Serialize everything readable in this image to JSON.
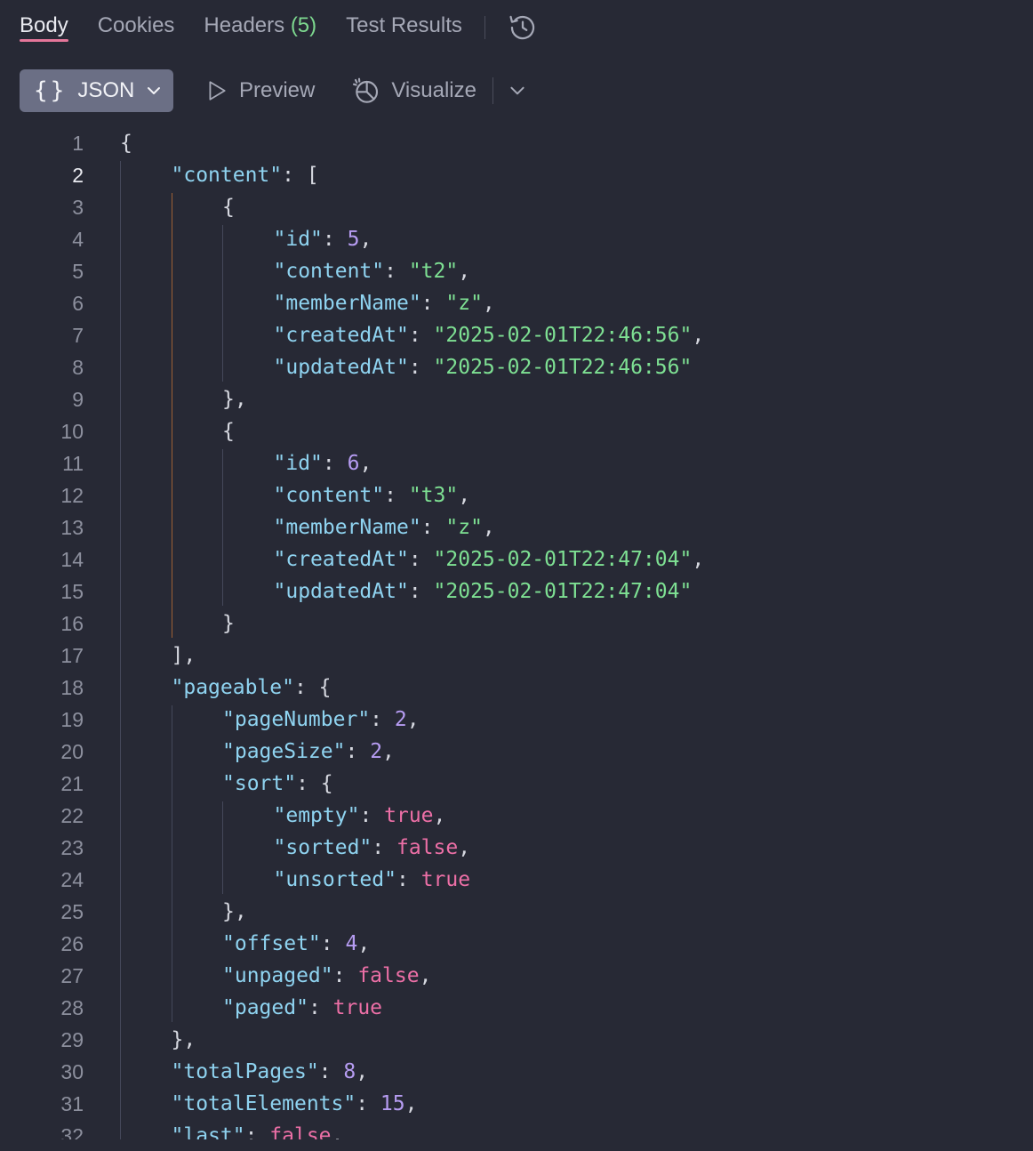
{
  "tabs": [
    {
      "label": "Body"
    },
    {
      "label": "Cookies"
    },
    {
      "label": "Headers",
      "count": "(5)"
    },
    {
      "label": "Test Results"
    }
  ],
  "toolbar": {
    "format_braces": "{}",
    "format_label": "JSON",
    "preview_label": "Preview",
    "visualize_label": "Visualize"
  },
  "colors": {
    "background": "#272935",
    "active_tab_underline": "#e5769a",
    "key": "#8fd3f0",
    "string": "#7ee093",
    "number": "#b69cf2",
    "boolean": "#ec6fa6"
  },
  "icons": [
    "history-icon",
    "chevron-down-icon",
    "play-icon",
    "visualize-icon"
  ],
  "code": {
    "current_line": 2,
    "lines": [
      [
        [
          "p",
          "{"
        ]
      ],
      [
        [
          "k",
          "\"content\""
        ],
        [
          "p",
          ": ["
        ]
      ],
      [
        [
          "p",
          "{"
        ]
      ],
      [
        [
          "k",
          "\"id\""
        ],
        [
          "p",
          ": "
        ],
        [
          "n",
          "5"
        ],
        [
          "p",
          ","
        ]
      ],
      [
        [
          "k",
          "\"content\""
        ],
        [
          "p",
          ": "
        ],
        [
          "s",
          "\"t2\""
        ],
        [
          "p",
          ","
        ]
      ],
      [
        [
          "k",
          "\"memberName\""
        ],
        [
          "p",
          ": "
        ],
        [
          "s",
          "\"z\""
        ],
        [
          "p",
          ","
        ]
      ],
      [
        [
          "k",
          "\"createdAt\""
        ],
        [
          "p",
          ": "
        ],
        [
          "s",
          "\"2025-02-01T22:46:56\""
        ],
        [
          "p",
          ","
        ]
      ],
      [
        [
          "k",
          "\"updatedAt\""
        ],
        [
          "p",
          ": "
        ],
        [
          "s",
          "\"2025-02-01T22:46:56\""
        ]
      ],
      [
        [
          "p",
          "},"
        ]
      ],
      [
        [
          "p",
          "{"
        ]
      ],
      [
        [
          "k",
          "\"id\""
        ],
        [
          "p",
          ": "
        ],
        [
          "n",
          "6"
        ],
        [
          "p",
          ","
        ]
      ],
      [
        [
          "k",
          "\"content\""
        ],
        [
          "p",
          ": "
        ],
        [
          "s",
          "\"t3\""
        ],
        [
          "p",
          ","
        ]
      ],
      [
        [
          "k",
          "\"memberName\""
        ],
        [
          "p",
          ": "
        ],
        [
          "s",
          "\"z\""
        ],
        [
          "p",
          ","
        ]
      ],
      [
        [
          "k",
          "\"createdAt\""
        ],
        [
          "p",
          ": "
        ],
        [
          "s",
          "\"2025-02-01T22:47:04\""
        ],
        [
          "p",
          ","
        ]
      ],
      [
        [
          "k",
          "\"updatedAt\""
        ],
        [
          "p",
          ": "
        ],
        [
          "s",
          "\"2025-02-01T22:47:04\""
        ]
      ],
      [
        [
          "p",
          "}"
        ]
      ],
      [
        [
          "p",
          "],"
        ]
      ],
      [
        [
          "k",
          "\"pageable\""
        ],
        [
          "p",
          ": {"
        ]
      ],
      [
        [
          "k",
          "\"pageNumber\""
        ],
        [
          "p",
          ": "
        ],
        [
          "n",
          "2"
        ],
        [
          "p",
          ","
        ]
      ],
      [
        [
          "k",
          "\"pageSize\""
        ],
        [
          "p",
          ": "
        ],
        [
          "n",
          "2"
        ],
        [
          "p",
          ","
        ]
      ],
      [
        [
          "k",
          "\"sort\""
        ],
        [
          "p",
          ": {"
        ]
      ],
      [
        [
          "k",
          "\"empty\""
        ],
        [
          "p",
          ": "
        ],
        [
          "b",
          "true"
        ],
        [
          "p",
          ","
        ]
      ],
      [
        [
          "k",
          "\"sorted\""
        ],
        [
          "p",
          ": "
        ],
        [
          "b",
          "false"
        ],
        [
          "p",
          ","
        ]
      ],
      [
        [
          "k",
          "\"unsorted\""
        ],
        [
          "p",
          ": "
        ],
        [
          "b",
          "true"
        ]
      ],
      [
        [
          "p",
          "},"
        ]
      ],
      [
        [
          "k",
          "\"offset\""
        ],
        [
          "p",
          ": "
        ],
        [
          "n",
          "4"
        ],
        [
          "p",
          ","
        ]
      ],
      [
        [
          "k",
          "\"unpaged\""
        ],
        [
          "p",
          ": "
        ],
        [
          "b",
          "false"
        ],
        [
          "p",
          ","
        ]
      ],
      [
        [
          "k",
          "\"paged\""
        ],
        [
          "p",
          ": "
        ],
        [
          "b",
          "true"
        ]
      ],
      [
        [
          "p",
          "},"
        ]
      ],
      [
        [
          "k",
          "\"totalPages\""
        ],
        [
          "p",
          ": "
        ],
        [
          "n",
          "8"
        ],
        [
          "p",
          ","
        ]
      ],
      [
        [
          "k",
          "\"totalElements\""
        ],
        [
          "p",
          ": "
        ],
        [
          "n",
          "15"
        ],
        [
          "p",
          ","
        ]
      ],
      [
        [
          "k",
          "\"last\""
        ],
        [
          "p",
          ": "
        ],
        [
          "b",
          "false"
        ],
        [
          "p",
          ","
        ]
      ]
    ]
  }
}
